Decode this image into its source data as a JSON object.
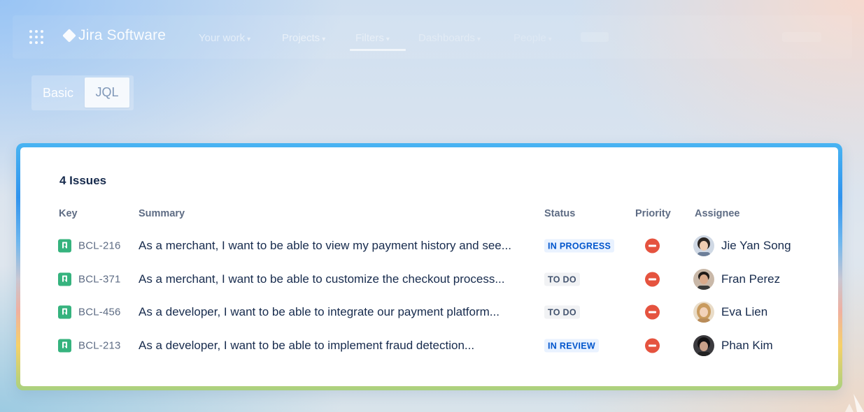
{
  "nav": {
    "logo_text": "Jira Software",
    "items": [
      {
        "label": "Your work"
      },
      {
        "label": "Projects"
      },
      {
        "label": "Filters"
      },
      {
        "label": "Dashboards"
      },
      {
        "label": "People"
      }
    ]
  },
  "search_mode": {
    "basic_label": "Basic",
    "jql_label": "JQL",
    "selected": "JQL"
  },
  "issues_panel": {
    "count_label": "4 Issues",
    "columns": {
      "key": "Key",
      "summary": "Summary",
      "status": "Status",
      "priority": "Priority",
      "assignee": "Assignee"
    },
    "rows": [
      {
        "key": "BCL-216",
        "summary": "As a merchant, I want to be able to view my payment history and see...",
        "status": "IN PROGRESS",
        "status_color": "#0055cc",
        "priority_icon": "priority-blocker-icon",
        "assignee": "Jie Yan Song"
      },
      {
        "key": "BCL-371",
        "summary": "As a merchant, I want to be able to customize the checkout process...",
        "status": "TO DO",
        "status_color": "#44546f",
        "priority_icon": "priority-blocker-icon",
        "assignee": "Fran Perez"
      },
      {
        "key": "BCL-456",
        "summary": "As a developer, I want to be able to integrate our payment platform...",
        "status": "TO DO",
        "status_color": "#44546f",
        "priority_icon": "priority-blocker-icon",
        "assignee": "Eva Lien"
      },
      {
        "key": "BCL-213",
        "summary": "As a developer, I want to be able to implement fraud detection...",
        "status": "IN REVIEW",
        "status_color": "#0055cc",
        "priority_icon": "priority-blocker-icon",
        "assignee": "Phan Kim"
      }
    ]
  },
  "colors": {
    "story_icon": "#36b37e",
    "priority_red": "#e5533f",
    "text_primary": "#172b4d",
    "text_subtle": "#5e6c84"
  }
}
